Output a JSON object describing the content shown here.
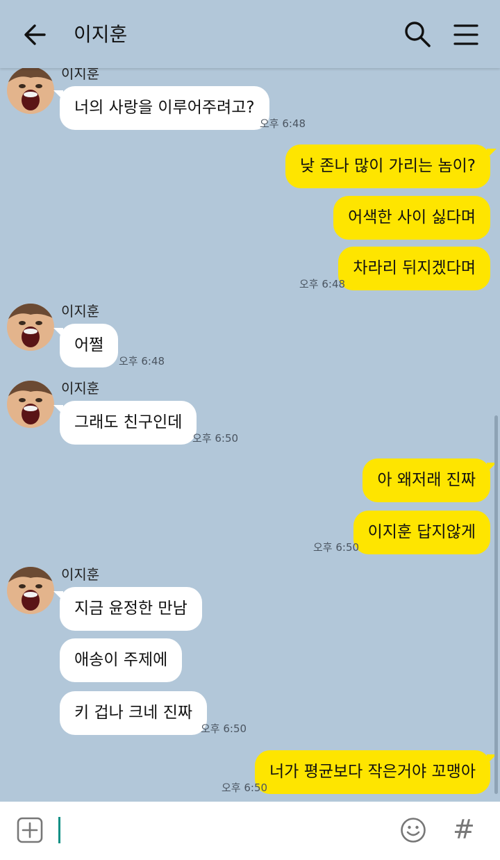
{
  "header": {
    "title": "이지훈",
    "back_icon": "arrow-left-icon",
    "search_icon": "search-icon",
    "menu_icon": "hamburger-menu-icon"
  },
  "colors": {
    "background": "#b2c7d9",
    "outgoing_bubble": "#fee500",
    "incoming_bubble": "#ffffff",
    "cursor": "#0f8f84"
  },
  "messages": {
    "g1": {
      "sender": "이지훈",
      "m1": "너의 사랑을 이루어주려고?",
      "time": "오후 6:48"
    },
    "g2": {
      "m1": "낮 존나 많이 가리는 놈이?",
      "m2": "어색한 사이 싫다며",
      "m3": "차라리 뒤지겠다며",
      "time": "오후 6:48"
    },
    "g3": {
      "sender": "이지훈",
      "m1": "어쩔",
      "time": "오후 6:48"
    },
    "g4": {
      "sender": "이지훈",
      "m1": "그래도 친구인데",
      "time": "오후 6:50"
    },
    "g5": {
      "m1": "아 왜저래 진짜",
      "m2": "이지훈 답지않게",
      "time": "오후 6:50"
    },
    "g6": {
      "sender": "이지훈",
      "m1": "지금 윤정한 만남",
      "m2": "애송이 주제에",
      "m3": "키 겁나 크네 진짜",
      "time": "오후 6:50"
    },
    "g7": {
      "m1": "너가 평균보다 작은거야 꼬맹아",
      "time": "오후 6:50"
    }
  },
  "input": {
    "plus_icon": "plus-square-icon",
    "emoji_icon": "emoji-icon",
    "hash_label": "#"
  }
}
